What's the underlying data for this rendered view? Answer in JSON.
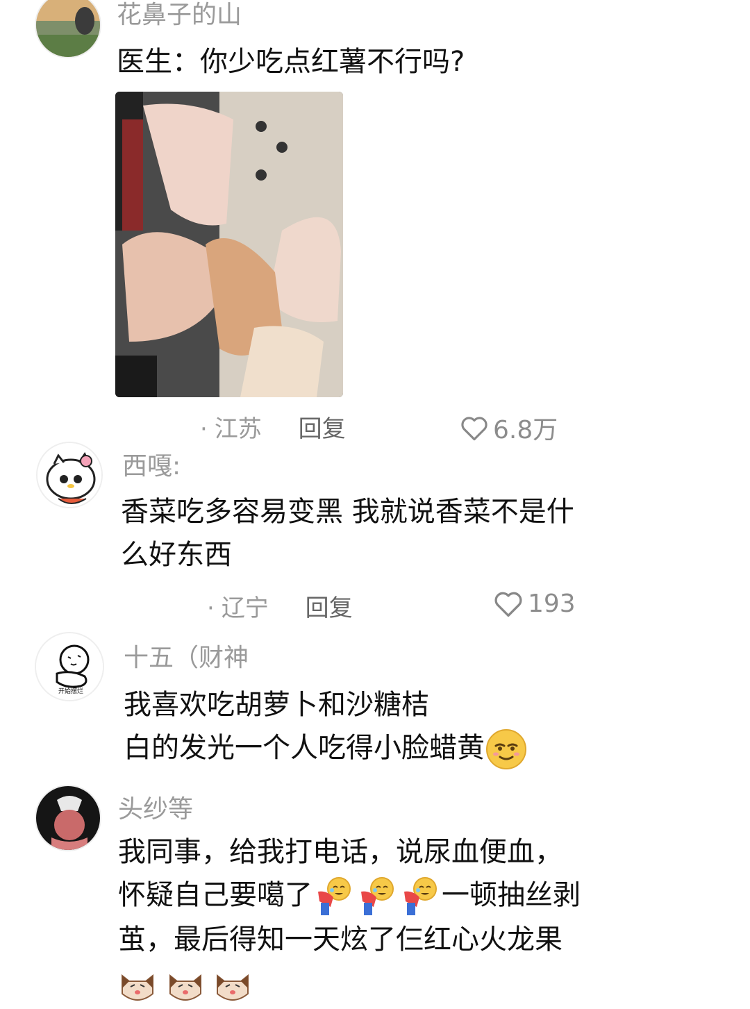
{
  "comments": [
    {
      "username": "花鼻子的山",
      "text_lines": [
        "医生：你少吃点红薯不行吗?"
      ],
      "location": "江苏",
      "reply_label": "回复",
      "likes": "6.8万"
    },
    {
      "username": "西嘎:",
      "text_lines": [
        "香菜吃多容易变黑  我就说香菜不是什",
        "么好东西"
      ],
      "location": "辽宁",
      "reply_label": "回复",
      "likes": "193"
    },
    {
      "username": "十五（财神",
      "avatar_caption": "开始摆烂",
      "text_lines": [
        "我喜欢吃胡萝卜和沙糖桔",
        "白的发光一个人吃得小脸蜡黄"
      ]
    },
    {
      "username": "头纱等",
      "text_lines": [
        "我同事，给我打电话，说尿血便血，",
        "怀疑自己要噶了",
        "一顿抽丝剥",
        "茧，最后得知一天炫了仨红心火龙果"
      ]
    }
  ],
  "icons": {
    "like": "heart-outline-icon",
    "emoji_smirk": "smirk-emoji-icon",
    "emoji_laugh_cry": "laugh-cry-bowing-emoji-icon",
    "emoji_cat": "cat-face-emoji-icon"
  },
  "colors": {
    "text": "#111111",
    "muted": "#9a9a9a",
    "background": "#ffffff"
  }
}
